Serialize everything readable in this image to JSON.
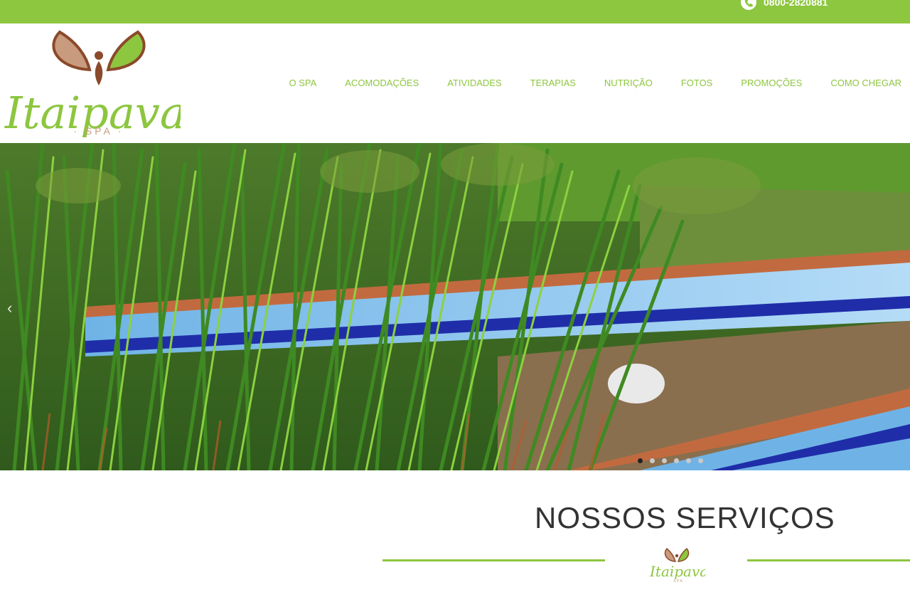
{
  "topbar": {
    "phone": "0800-2820881",
    "phone_icon": "phone-icon"
  },
  "brand": {
    "name": "Itaipava",
    "sub": "· SPA ·",
    "colors": {
      "green": "#8dc63f",
      "brown": "#8b4a2b",
      "tan": "#c99b7e"
    }
  },
  "nav": [
    {
      "label": "O SPA"
    },
    {
      "label": "ACOMODAÇÕES"
    },
    {
      "label": "ATIVIDADES"
    },
    {
      "label": "TERAPIAS"
    },
    {
      "label": "NUTRIÇÃO"
    },
    {
      "label": "FOTOS"
    },
    {
      "label": "PROMOÇÕES"
    },
    {
      "label": "COMO CHEGAR"
    }
  ],
  "slider": {
    "prev_icon": "chevron-left-icon",
    "prev_glyph": "‹",
    "slide_count": 6,
    "active_index": 0
  },
  "services": {
    "title": "NOSSOS SERVIÇOS"
  }
}
